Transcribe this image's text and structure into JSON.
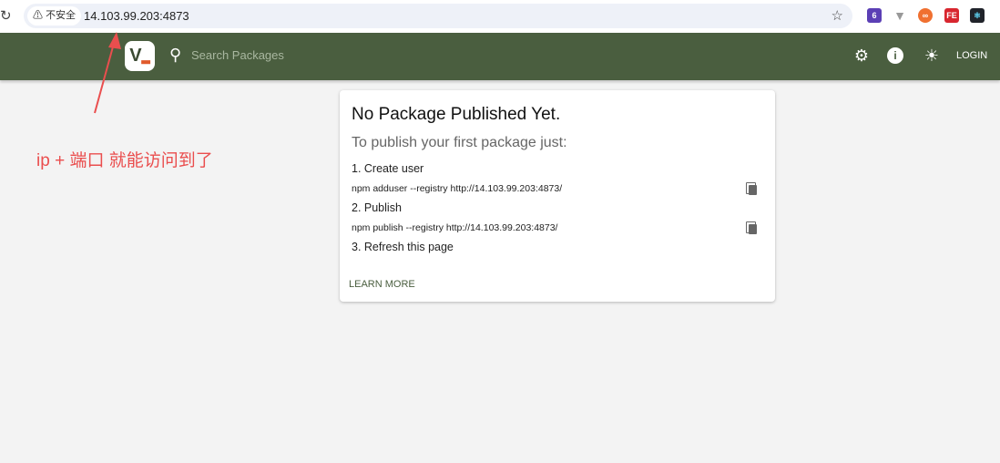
{
  "browser": {
    "security_label": "不安全",
    "url": "14.103.99.203:4873",
    "ext_badge": "6",
    "ext_fe": "FE"
  },
  "header": {
    "search_placeholder": "Search Packages",
    "login_label": "LOGIN",
    "logo_text": "V"
  },
  "card": {
    "title": "No Package Published Yet.",
    "subtitle": "To publish your first package just:",
    "steps": [
      {
        "label": "1. Create user",
        "command": "npm adduser --registry http://14.103.99.203:4873/"
      },
      {
        "label": "2. Publish",
        "command": "npm publish --registry http://14.103.99.203:4873/"
      },
      {
        "label": "3. Refresh this page"
      }
    ],
    "learn_more": "LEARN MORE"
  },
  "annotation": {
    "text": "ip + 端口 就能访问到了",
    "color": "#ea4e4e"
  }
}
